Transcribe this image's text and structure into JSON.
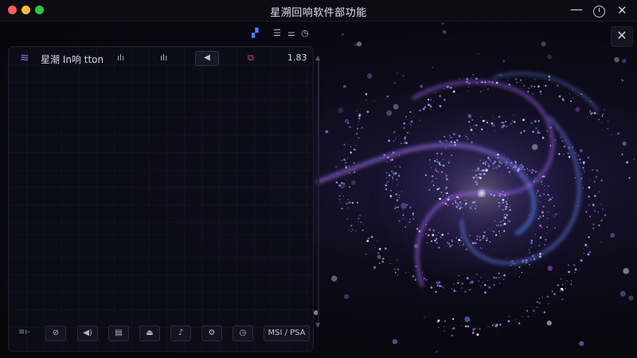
{
  "window": {
    "title": "星溯回响软件部功能",
    "controls": {
      "minimize": "—",
      "close": "✕"
    }
  },
  "mini_toolbar": [
    {
      "icon": "grid-icon",
      "glyph": "▞",
      "color": "#4f7dff"
    },
    {
      "icon": "sliders-icon",
      "glyph": "☰"
    },
    {
      "icon": "settings-icon",
      "glyph": "⚌"
    },
    {
      "icon": "clock-icon",
      "glyph": "◷"
    }
  ],
  "overlay_close": "✕",
  "panel": {
    "header": {
      "title": "星潮 In响 tton",
      "icons": [
        "ılı",
        "ıIı"
      ],
      "box_label": "◀",
      "record_glyph": "⧉",
      "time": "1.83"
    },
    "bottom": {
      "first": "≡ı-",
      "buttons": [
        "⊘",
        "◀)",
        "▤",
        "⏏",
        "♪",
        "⚙",
        "◷"
      ],
      "mode_label": "MSI / PSA"
    }
  },
  "colors": {
    "accent_purple": "#a56bff",
    "accent_blue": "#5a8cff",
    "record_red": "#e5484d"
  }
}
